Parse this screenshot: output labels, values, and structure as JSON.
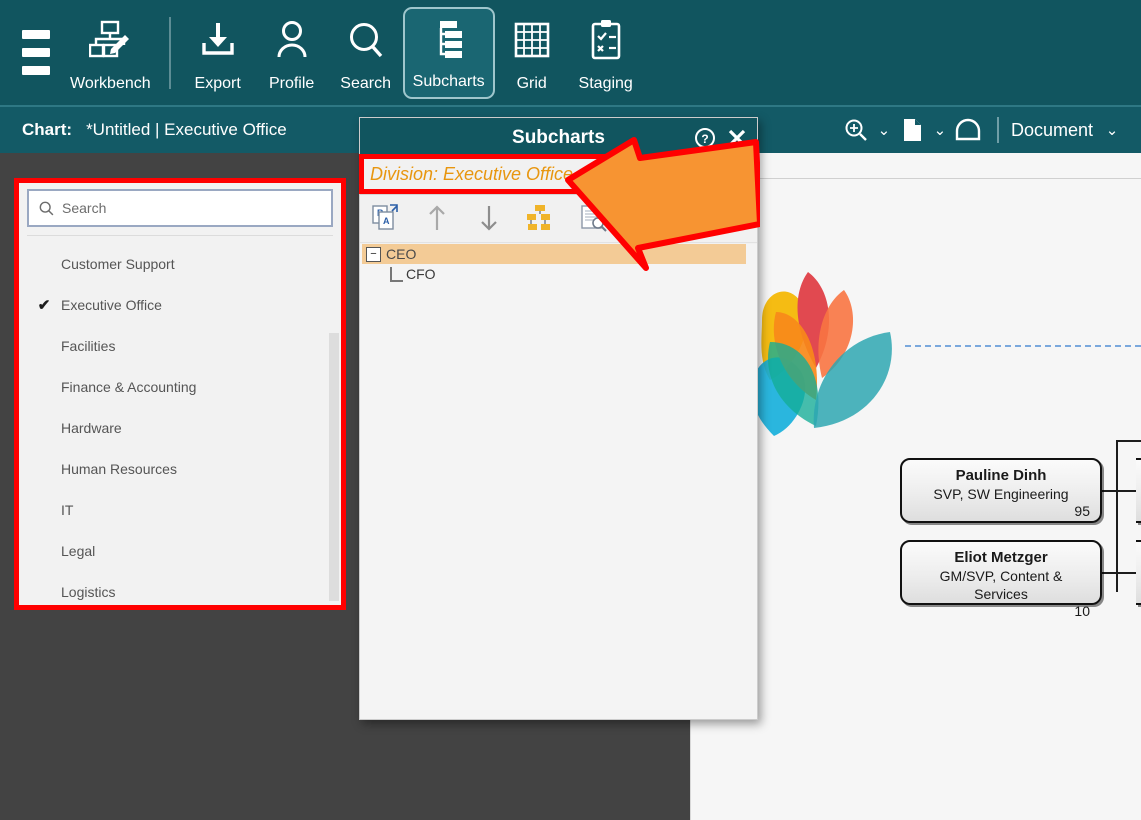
{
  "ribbon": {
    "menu_icon": "hamburger-icon",
    "items": [
      {
        "label": "Workbench",
        "icon": "workbench-icon",
        "selected": false
      },
      {
        "label": "Export",
        "icon": "export-icon",
        "selected": false
      },
      {
        "label": "Profile",
        "icon": "profile-icon",
        "selected": false
      },
      {
        "label": "Search",
        "icon": "search-icon",
        "selected": false
      },
      {
        "label": "Subcharts",
        "icon": "subcharts-icon",
        "selected": true
      },
      {
        "label": "Grid",
        "icon": "grid-icon",
        "selected": false
      },
      {
        "label": "Staging",
        "icon": "staging-icon",
        "selected": false
      }
    ]
  },
  "chartbar": {
    "label": "Chart:",
    "value": "*Untitled | Executive Office",
    "zoom_icon": "zoom-in-icon",
    "page_icon": "page-icon",
    "undo_icon": "arch-icon",
    "mode_label": "Document",
    "caret": "⌄"
  },
  "division_dropdown": {
    "search_placeholder": "Search",
    "search_value": "",
    "search_icon": "search-icon",
    "selected": "Executive Office",
    "check_glyph": "✔",
    "options": [
      "Customer Support",
      "Executive Office",
      "Facilities",
      "Finance & Accounting",
      "Hardware",
      "Human Resources",
      "IT",
      "Legal",
      "Logistics"
    ]
  },
  "subcharts_dialog": {
    "title": "Subcharts",
    "help_icon": "help-circle-icon",
    "close_icon": "close-icon",
    "division_banner": "Division: Executive Office",
    "division_banner_color": "#e8960f",
    "toolbar": [
      {
        "name": "rename-pages-button",
        "icon": "page-swap-icon"
      },
      {
        "name": "move-up-button",
        "icon": "arrow-up-icon"
      },
      {
        "name": "move-down-button",
        "icon": "arrow-down-icon"
      },
      {
        "name": "hierarchy-button",
        "icon": "org-hierarchy-icon"
      },
      {
        "name": "preview-button",
        "icon": "document-search-icon"
      }
    ],
    "tree": {
      "root": {
        "label": "CEO",
        "expanded": true,
        "expander": "−",
        "selected": true
      },
      "children": [
        {
          "label": "CFO"
        }
      ]
    },
    "highlight_color": "#f3cb96"
  },
  "canvas": {
    "logo_icon": "lotus-flower-logo",
    "nodes": [
      {
        "name": "Pauline Dinh",
        "title": "SVP, SW Engineering",
        "count": "95"
      },
      {
        "name": "Eliot Metzger",
        "title": "GM/SVP, Content & Services",
        "count": "10"
      }
    ]
  },
  "annotations": {
    "arrow_icon": "pointer-arrow-icon",
    "arrow_color": "#f79432",
    "outline_color": "#ff0000"
  }
}
